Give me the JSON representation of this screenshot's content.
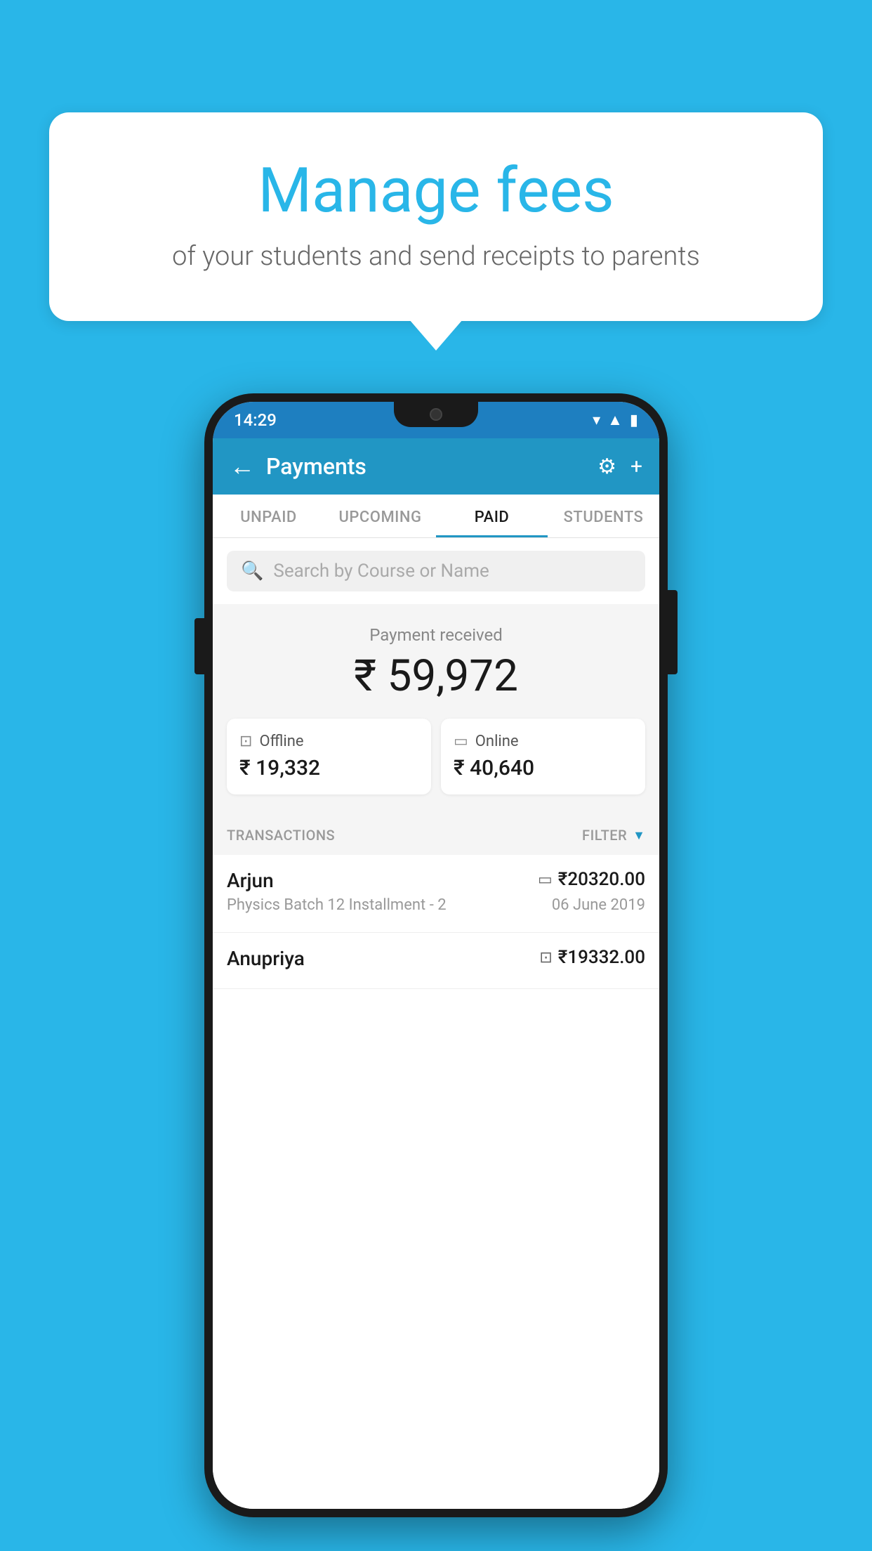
{
  "page": {
    "background_color": "#29b6e8"
  },
  "speech_bubble": {
    "title": "Manage fees",
    "subtitle": "of your students and send receipts to parents"
  },
  "status_bar": {
    "time": "14:29",
    "wifi": "▾",
    "signal": "▲",
    "battery": "▮"
  },
  "app_header": {
    "title": "Payments",
    "back_icon": "←",
    "gear_icon": "⚙",
    "plus_icon": "+"
  },
  "tabs": [
    {
      "label": "UNPAID",
      "active": false
    },
    {
      "label": "UPCOMING",
      "active": false
    },
    {
      "label": "PAID",
      "active": true
    },
    {
      "label": "STUDENTS",
      "active": false
    }
  ],
  "search": {
    "placeholder": "Search by Course or Name",
    "icon": "🔍"
  },
  "payment_received": {
    "label": "Payment received",
    "amount": "₹ 59,972",
    "offline": {
      "type": "Offline",
      "amount": "₹ 19,332",
      "icon": "🪙"
    },
    "online": {
      "type": "Online",
      "amount": "₹ 40,640",
      "icon": "💳"
    }
  },
  "transactions": {
    "label": "TRANSACTIONS",
    "filter_label": "FILTER",
    "items": [
      {
        "name": "Arjun",
        "detail": "Physics Batch 12 Installment - 2",
        "amount": "₹20320.00",
        "date": "06 June 2019",
        "pay_type": "online"
      },
      {
        "name": "Anupriya",
        "detail": "",
        "amount": "₹19332.00",
        "date": "",
        "pay_type": "offline"
      }
    ]
  }
}
